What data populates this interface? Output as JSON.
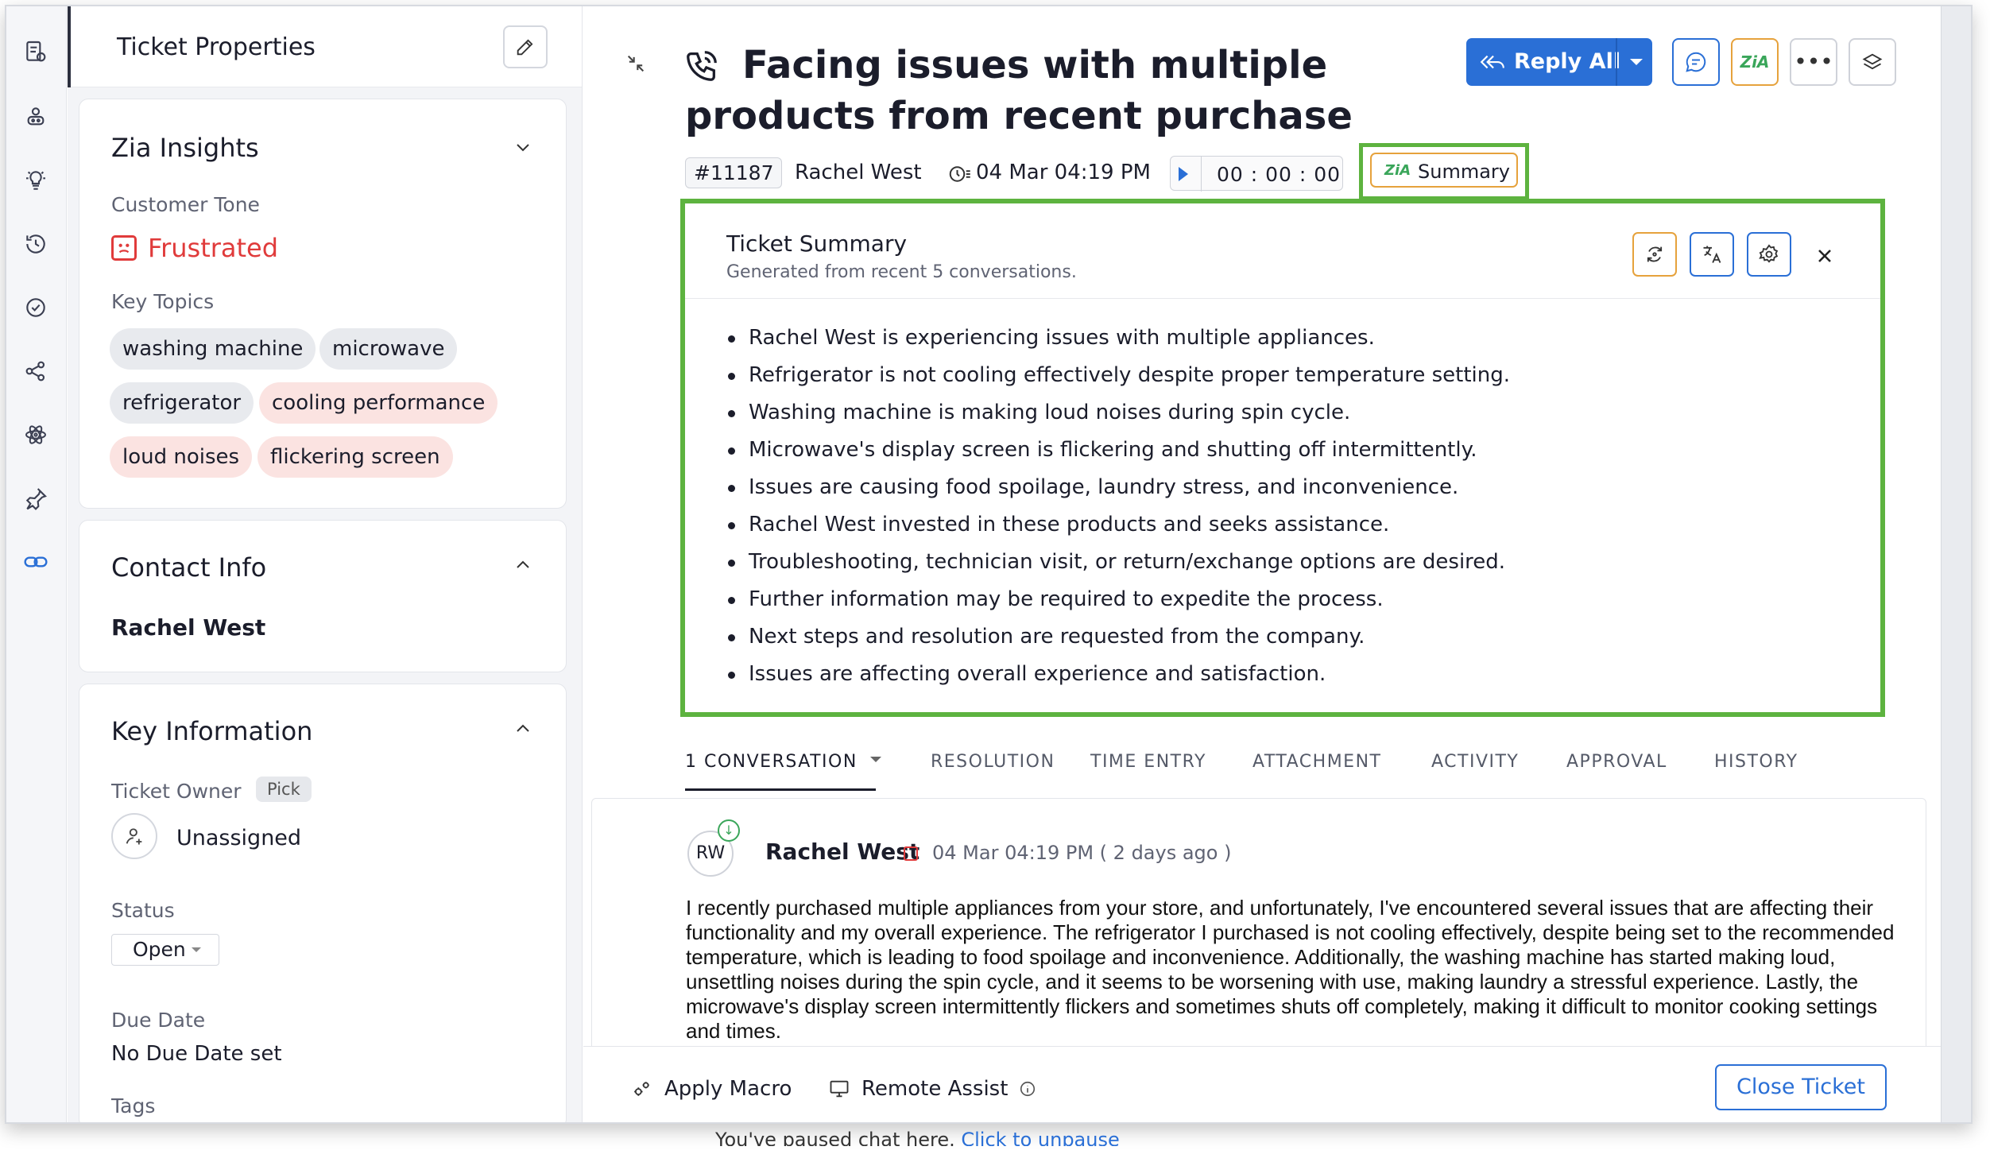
{
  "props": {
    "title": "Ticket Properties",
    "zia": {
      "title": "Zia Insights",
      "tone_label": "Customer Tone",
      "tone_value": "Frustrated",
      "topics_label": "Key Topics",
      "topics": [
        "washing machine",
        "microwave",
        "refrigerator",
        "cooling performance",
        "loud noises",
        "flickering screen"
      ]
    },
    "contact": {
      "title": "Contact Info",
      "name": "Rachel West"
    },
    "key_info": {
      "title": "Key Information",
      "owner_label": "Ticket Owner",
      "pick": "Pick",
      "owner_value": "Unassigned",
      "status_label": "Status",
      "status_value": "Open",
      "due_label": "Due Date",
      "due_value": "No Due Date set",
      "tags_label": "Tags"
    }
  },
  "ticket": {
    "title": "Facing issues with multiple products from recent purchase",
    "id": "#11187",
    "contact": "Rachel West",
    "created": "04 Mar 04:19 PM",
    "timer": "00 : 00 : 00",
    "reply_all": "Reply All",
    "summary_button": "Summary",
    "zia_logo": "ZiA"
  },
  "summary": {
    "title": "Ticket Summary",
    "subtitle": "Generated from recent 5 conversations.",
    "points": [
      "Rachel West is experiencing issues with multiple appliances.",
      "Refrigerator is not cooling effectively despite proper temperature setting.",
      "Washing machine is making loud noises during spin cycle.",
      "Microwave's display screen is flickering and shutting off intermittently.",
      "Issues are causing food spoilage, laundry stress, and inconvenience.",
      "Rachel West invested in these products and seeks assistance.",
      "Troubleshooting, technician visit, or return/exchange options are desired.",
      "Further information may be required to expedite the process.",
      "Next steps and resolution are requested from the company.",
      "Issues are affecting overall experience and satisfaction."
    ]
  },
  "tabs": [
    "1 CONVERSATION",
    "RESOLUTION",
    "TIME ENTRY",
    "ATTACHMENT",
    "ACTIVITY",
    "APPROVAL",
    "HISTORY"
  ],
  "thread": {
    "initials": "RW",
    "sender": "Rachel West",
    "time": "04 Mar 04:19 PM ( 2 days ago )",
    "message": "I recently purchased multiple appliances from your store, and unfortunately, I've encountered several issues that are affecting their functionality and my overall experience. The refrigerator I purchased is not cooling effectively, despite being set to the recommended temperature, which is leading to food spoilage and inconvenience. Additionally, the washing machine has started making loud, unsettling noises during the spin cycle, and it seems to be worsening with use, making laundry a stressful experience. Lastly, the microwave's display screen intermittently flickers and sometimes shuts off completely, making it difficult to monitor cooking settings and times."
  },
  "footer": {
    "apply_macro": "Apply Macro",
    "remote_assist": "Remote Assist",
    "close_ticket": "Close Ticket"
  },
  "chat_note": {
    "text": "You've paused chat here.",
    "link": "Click to unpause"
  },
  "colors": {
    "accent": "#2a6fd6",
    "highlight": "#5db33f",
    "frustrated": "#e03b3b",
    "zia": "#e6a23c"
  }
}
